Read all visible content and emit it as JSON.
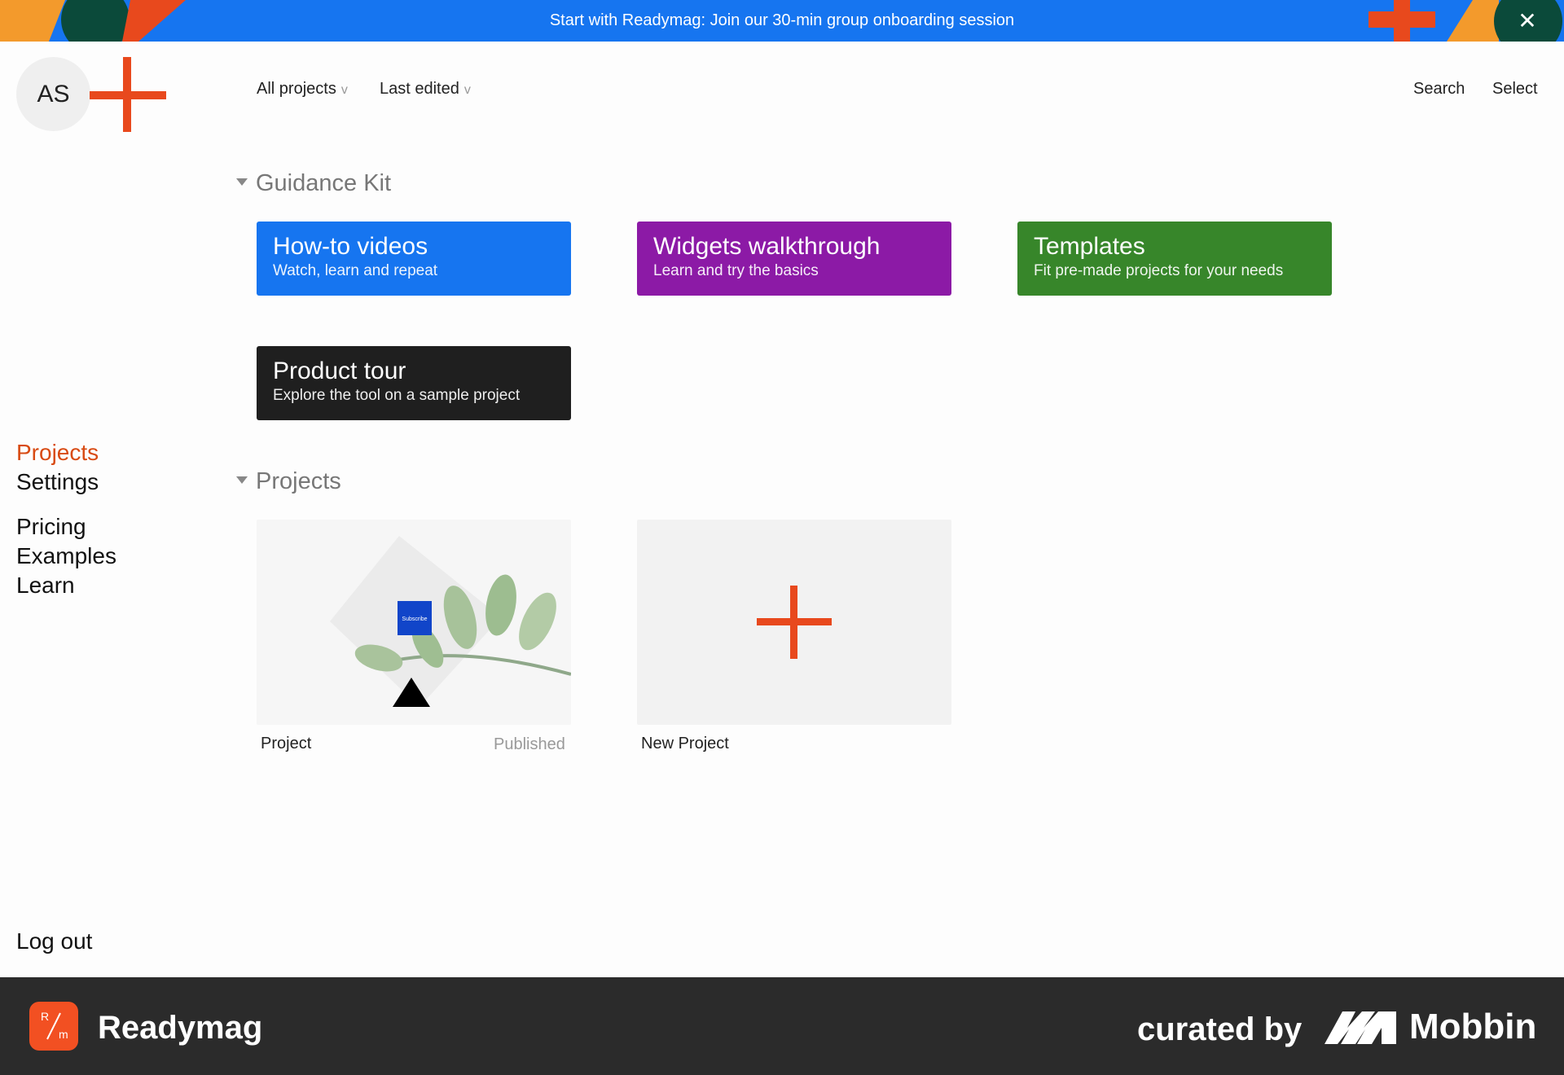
{
  "banner": {
    "text": "Start with Readymag: Join our 30-min group onboarding session",
    "close_icon": "close-icon",
    "color": "#1675f0"
  },
  "header": {
    "avatar_initials": "AS",
    "add_icon": "plus-icon",
    "filters": [
      {
        "label": "All projects",
        "chevron": "v"
      },
      {
        "label": "Last edited",
        "chevron": "v"
      }
    ],
    "search_label": "Search",
    "select_label": "Select"
  },
  "sidebar": {
    "items": [
      {
        "label": "Projects",
        "active": true
      },
      {
        "label": "Settings"
      },
      {
        "label": "Pricing"
      },
      {
        "label": "Examples"
      },
      {
        "label": "Learn"
      }
    ],
    "logout_label": "Log out"
  },
  "guidance": {
    "title": "Guidance Kit",
    "cards": [
      {
        "title": "How-to videos",
        "subtitle": "Watch, learn and repeat",
        "color": "#1675f0"
      },
      {
        "title": "Widgets walkthrough",
        "subtitle": "Learn and try the basics",
        "color": "#8c1aa6"
      },
      {
        "title": "Templates",
        "subtitle": "Fit pre-made projects for your needs",
        "color": "#37862a"
      },
      {
        "title": "Product tour",
        "subtitle": "Explore the tool on a sample project",
        "color": "#1f1f1f"
      }
    ]
  },
  "projects": {
    "title": "Projects",
    "items": [
      {
        "name": "Project",
        "status": "Published",
        "thumb_button": "Subscribe"
      },
      {
        "name": "New Project"
      }
    ]
  },
  "footer": {
    "brand": "Readymag",
    "curated_by": "curated by",
    "partner": "Mobbin",
    "logo_letters": [
      "R",
      "m"
    ]
  },
  "accent_color": "#e8491d"
}
